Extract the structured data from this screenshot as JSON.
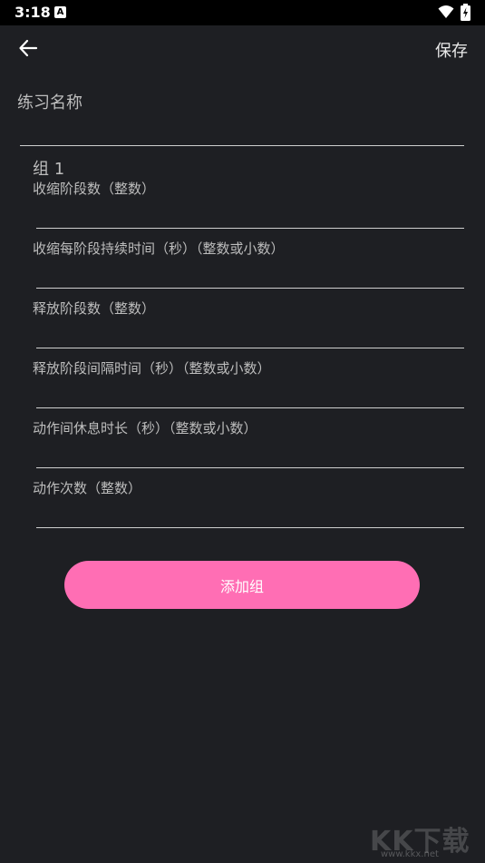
{
  "status_bar": {
    "time": "3:18",
    "notification_letter": "A"
  },
  "toolbar": {
    "save_label": "保存"
  },
  "form": {
    "name_label": "练习名称",
    "group_title": "组 1",
    "fields": [
      {
        "label": "收缩阶段数（整数）"
      },
      {
        "label": "收缩每阶段持续时间（秒）（整数或小数）"
      },
      {
        "label": "释放阶段数（整数）"
      },
      {
        "label": "释放阶段间隔时间（秒）（整数或小数）"
      },
      {
        "label": "动作间休息时长（秒）（整数或小数）"
      },
      {
        "label": "动作次数（整数）"
      }
    ],
    "add_group_label": "添加组"
  },
  "watermark": {
    "text": "KK下载",
    "url": "www.kkx.net"
  },
  "colors": {
    "background": "#1e1f23",
    "accent": "#ff6eb4"
  }
}
